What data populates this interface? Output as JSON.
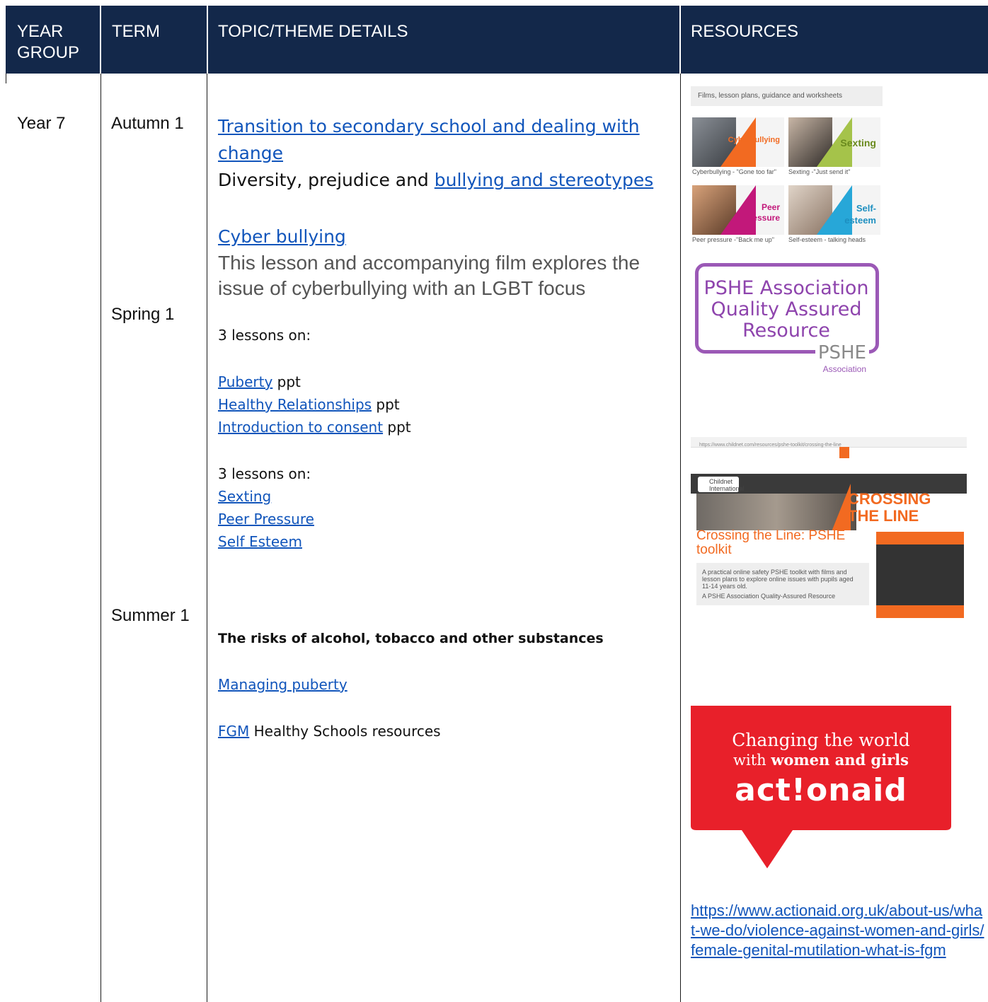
{
  "header": {
    "col_year": "YEAR GROUP",
    "col_term": "TERM",
    "col_topic": "TOPIC/THEME DETAILS",
    "col_resources": "RESOURCES"
  },
  "row": {
    "year": "Year 7",
    "terms": {
      "autumn": "Autumn 1",
      "spring": "Spring 1",
      "summer": "Summer 1"
    },
    "topics": {
      "transition_link": "Transition to secondary school and dealing with change",
      "diversity_text": "Diversity, prejudice and ",
      "bullying_link": "bullying and stereotypes",
      "cyber_link": "Cyber bullying",
      "cyber_desc": "This lesson and accompanying film explores the issue of cyberbullying with an LGBT focus",
      "lessons_intro_1": "3 lessons on:",
      "puberty_link": "Puberty",
      "healthy_link": "Healthy Relationships",
      "consent_link": "Introduction to consent",
      "ppt_suffix": " ppt",
      "lessons_intro_2": "3 lessons on:",
      "sexting_link": "Sexting",
      "peer_link": "Peer Pressure",
      "esteem_link": "Self Esteem",
      "risks_heading": "The risks of alcohol, tobacco and other substances",
      "managing_link": "Managing puberty",
      "fgm_link": "FGM",
      "fgm_suffix": " Healthy Schools resources"
    },
    "resources": {
      "childnet_grid": {
        "bar_text": "Films, lesson plans, guidance and worksheets",
        "tiles": [
          {
            "label": "Cyberbullying",
            "caption": "Cyberbullying - \"Gone too far\""
          },
          {
            "label": "Sexting",
            "caption": "Sexting -\"Just send it\""
          },
          {
            "label": "Peer Pressure",
            "caption": "Peer pressure -\"Back me up\""
          },
          {
            "label": "Self-esteem",
            "caption": "Self-esteem - talking heads"
          }
        ]
      },
      "pshe_badge": {
        "line1": "PSHE Association",
        "line2": "Quality Assured",
        "line3": "Resource",
        "logo": "PSHE",
        "logo_sub": "Association"
      },
      "childnet_page": {
        "url": "https://www.childnet.com/resources/pshe-toolkit/crossing-the-line",
        "logo": "Childnet International",
        "banner": "CROSSING THE LINE",
        "title": "Crossing the Line: PSHE toolkit",
        "desc": "A practical online safety PSHE toolkit with films and lesson plans to explore online issues with pupils aged 11-14 years old.",
        "note": "A PSHE Association Quality-Assured Resource"
      },
      "actionaid": {
        "line1": "Changing the world",
        "line2_pre": "with ",
        "line2_bold": "women and girls",
        "logo": "act!onaid",
        "link": "https://www.actionaid.org.uk/about-us/what-we-do/violence-against-women-and-girls/female-genital-mutilation-what-is-fgm"
      }
    },
    "colors": {
      "header_bg": "#13284a",
      "link": "#1155bb",
      "actionaid_red": "#e8202a",
      "childnet_orange": "#f26a21",
      "pshe_purple": "#9b59b6"
    }
  }
}
